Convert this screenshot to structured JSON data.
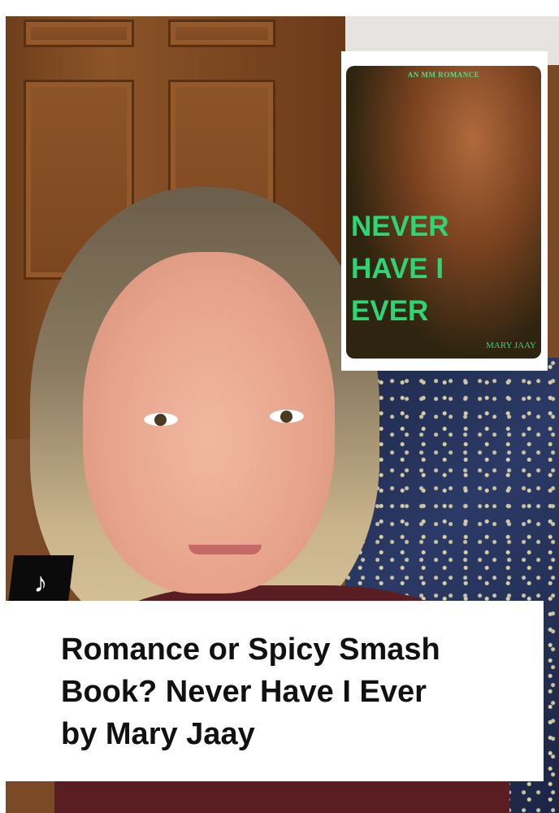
{
  "cover": {
    "tag": "AN MM ROMANCE",
    "title_lines": [
      "NEVER",
      "HAVE I",
      "EVER"
    ],
    "author": "MARY JAAY"
  },
  "badge": {
    "icon": "tiktok-icon"
  },
  "caption": {
    "line1": "Romance or Spicy Smash",
    "line2": "Book? Never Have I Ever",
    "line3": "by Mary Jaay"
  },
  "colors": {
    "cover_text": "#2fd475",
    "caption_text": "#111111",
    "badge_bg": "#0b0b0b"
  }
}
